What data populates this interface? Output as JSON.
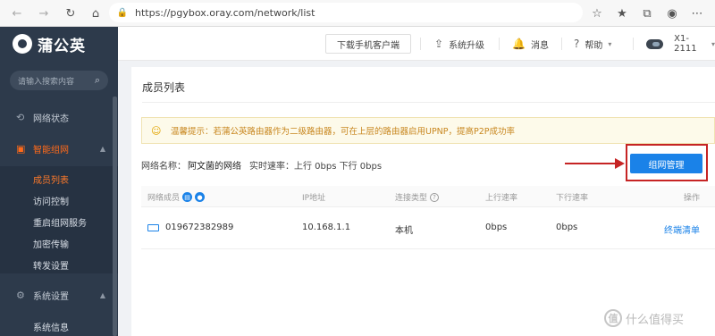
{
  "browser": {
    "url": "https://pgybox.oray.com/network/list",
    "icons": [
      "back-icon",
      "forward-icon",
      "refresh-icon",
      "home-icon",
      "lock-icon",
      "favorite-icon",
      "favorites-bar-icon",
      "collections-icon",
      "profile-icon",
      "more-icon"
    ]
  },
  "header": {
    "logo_text": "蒲公英",
    "download_label": "下载手机客户端",
    "upgrade_label": "系统升级",
    "message_label": "消息",
    "help_label": "帮助",
    "device_label": "X1-2111"
  },
  "sidebar": {
    "search_placeholder": "请输入搜索内容",
    "items": [
      {
        "label": "网络状态",
        "icon": "network-status-icon"
      },
      {
        "label": "智能组网",
        "icon": "network-icon",
        "active": true
      },
      {
        "label": "系统设置",
        "icon": "gear-icon"
      }
    ],
    "sub_items": [
      "成员列表",
      "访问控制",
      "重启组网服务",
      "加密传输",
      "转发设置"
    ],
    "system_sub_items": [
      "系统信息"
    ]
  },
  "content": {
    "title": "成员列表",
    "tip": "温馨提示：若蒲公英路由器作为二级路由器，可在上层的路由器启用UPNP，提高P2P成功率",
    "network_name_label": "网络名称：",
    "network_name_value": "阿文菌的网络",
    "speed_text": "实时速率：上行 0bps 下行 0bps",
    "manage_button": "组网管理",
    "table": {
      "headers": [
        "网络成员",
        "IP地址",
        "连接类型",
        "上行速率",
        "下行速率",
        "操作"
      ],
      "rows": [
        {
          "member": "019672382989",
          "ip": "10.168.1.1",
          "type": "本机",
          "up": "0bps",
          "down": "0bps",
          "action": "终端清单"
        }
      ]
    }
  },
  "watermark": "什么值得买"
}
